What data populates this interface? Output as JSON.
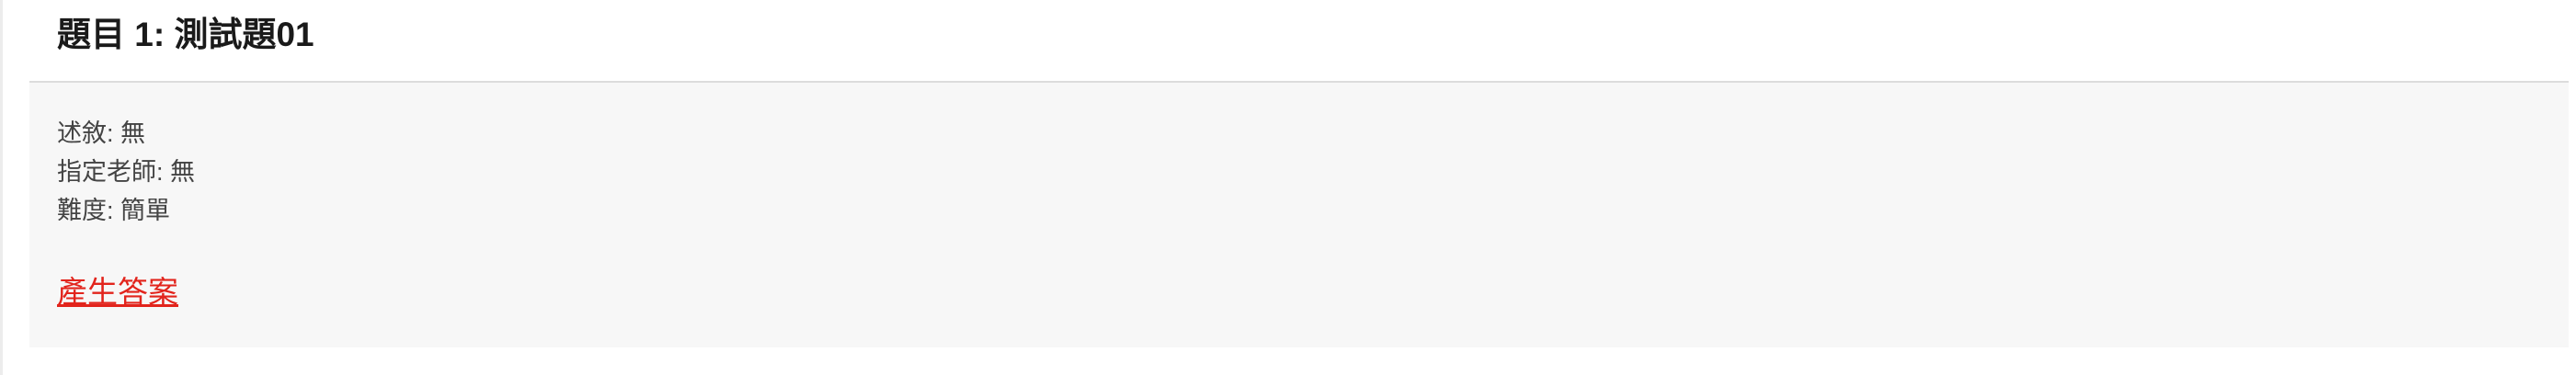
{
  "question": {
    "title": "題目 1: 測試題01",
    "description": "述敘: 無",
    "assigned_teacher": "指定老師: 無",
    "difficulty": "難度: 簡單",
    "action_link": "產生答案"
  },
  "colors": {
    "link": "#e2241c",
    "body_background": "#f7f7f7",
    "title_text": "#1a1a1a",
    "meta_text": "#444444"
  }
}
